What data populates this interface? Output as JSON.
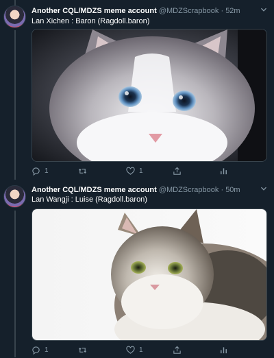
{
  "tweets": [
    {
      "name": "Another CQL/MDZS meme account",
      "handle": "@MDZScrapbook",
      "time": "· 52m",
      "text": "Lan Xichen : Baron (Ragdoll.baron)",
      "reply_count": "1",
      "like_count": "1"
    },
    {
      "name": "Another CQL/MDZS meme account",
      "handle": "@MDZScrapbook",
      "time": "· 50m",
      "text": "Lan Wangji : Luise (Ragdoll.baron)",
      "reply_count": "1",
      "like_count": "1"
    }
  ],
  "icons": {
    "more": "chevron-down-icon",
    "reply": "reply-icon",
    "retweet": "retweet-icon",
    "like": "heart-icon",
    "share": "share-icon",
    "analytics": "analytics-icon"
  },
  "colors": {
    "background": "#15202b",
    "secondary_text": "#8899a6",
    "border": "#38444d"
  }
}
